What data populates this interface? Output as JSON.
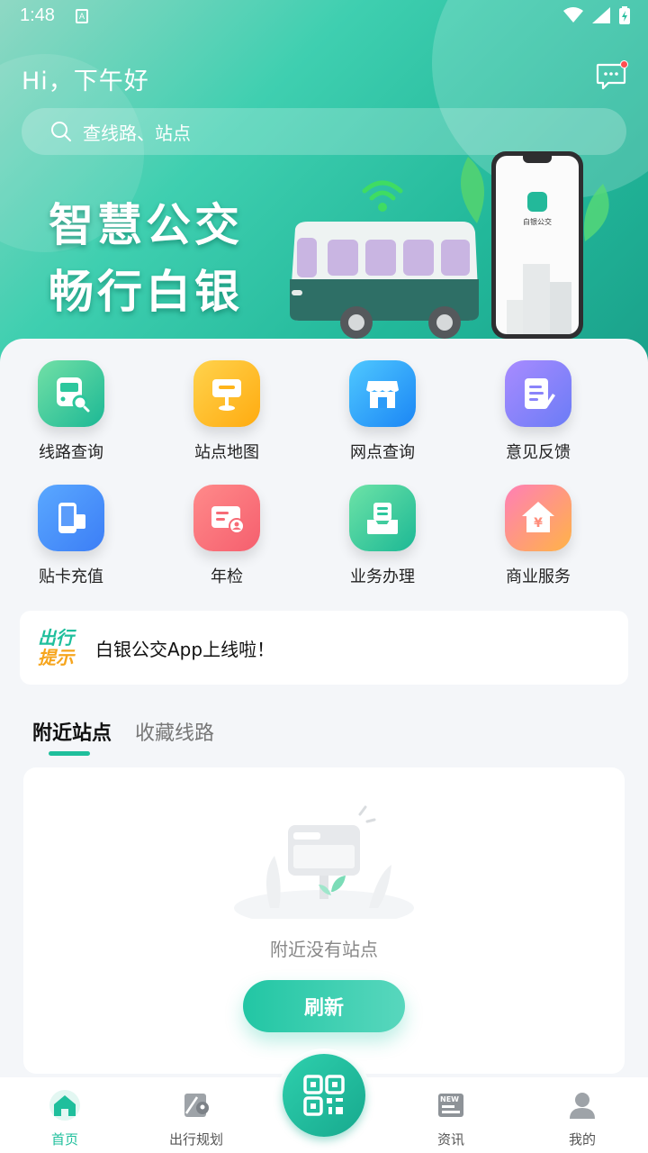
{
  "status": {
    "time": "1:48"
  },
  "header": {
    "greeting": "Hi，下午好"
  },
  "search": {
    "placeholder": "查线路、站点"
  },
  "banner": {
    "slogan_line1": "智慧公交",
    "slogan_line2": "畅行白银",
    "app_name": "白银公交"
  },
  "grid": [
    {
      "label": "线路查询",
      "icon": "bus-search-icon"
    },
    {
      "label": "站点地图",
      "icon": "station-sign-icon"
    },
    {
      "label": "网点查询",
      "icon": "store-icon"
    },
    {
      "label": "意见反馈",
      "icon": "feedback-note-icon"
    },
    {
      "label": "贴卡充值",
      "icon": "phone-card-icon"
    },
    {
      "label": "年检",
      "icon": "card-inspection-icon"
    },
    {
      "label": "业务办理",
      "icon": "inbox-tray-icon"
    },
    {
      "label": "商业服务",
      "icon": "shop-yen-icon"
    }
  ],
  "notice": {
    "badge_line1": "出行",
    "badge_line2": "提示",
    "text": "白银公交App上线啦！"
  },
  "tabs": [
    {
      "label": "附近站点"
    },
    {
      "label": "收藏线路"
    }
  ],
  "empty": {
    "message": "附近没有站点",
    "button": "刷新"
  },
  "nav": [
    {
      "label": "首页",
      "icon": "home-icon"
    },
    {
      "label": "出行规划",
      "icon": "map-pin-icon"
    },
    {
      "label": "资讯",
      "icon": "news-icon"
    },
    {
      "label": "我的",
      "icon": "user-icon"
    }
  ],
  "colors": {
    "accent": "#1fbf9c",
    "notice_orange": "#f6a51d"
  }
}
